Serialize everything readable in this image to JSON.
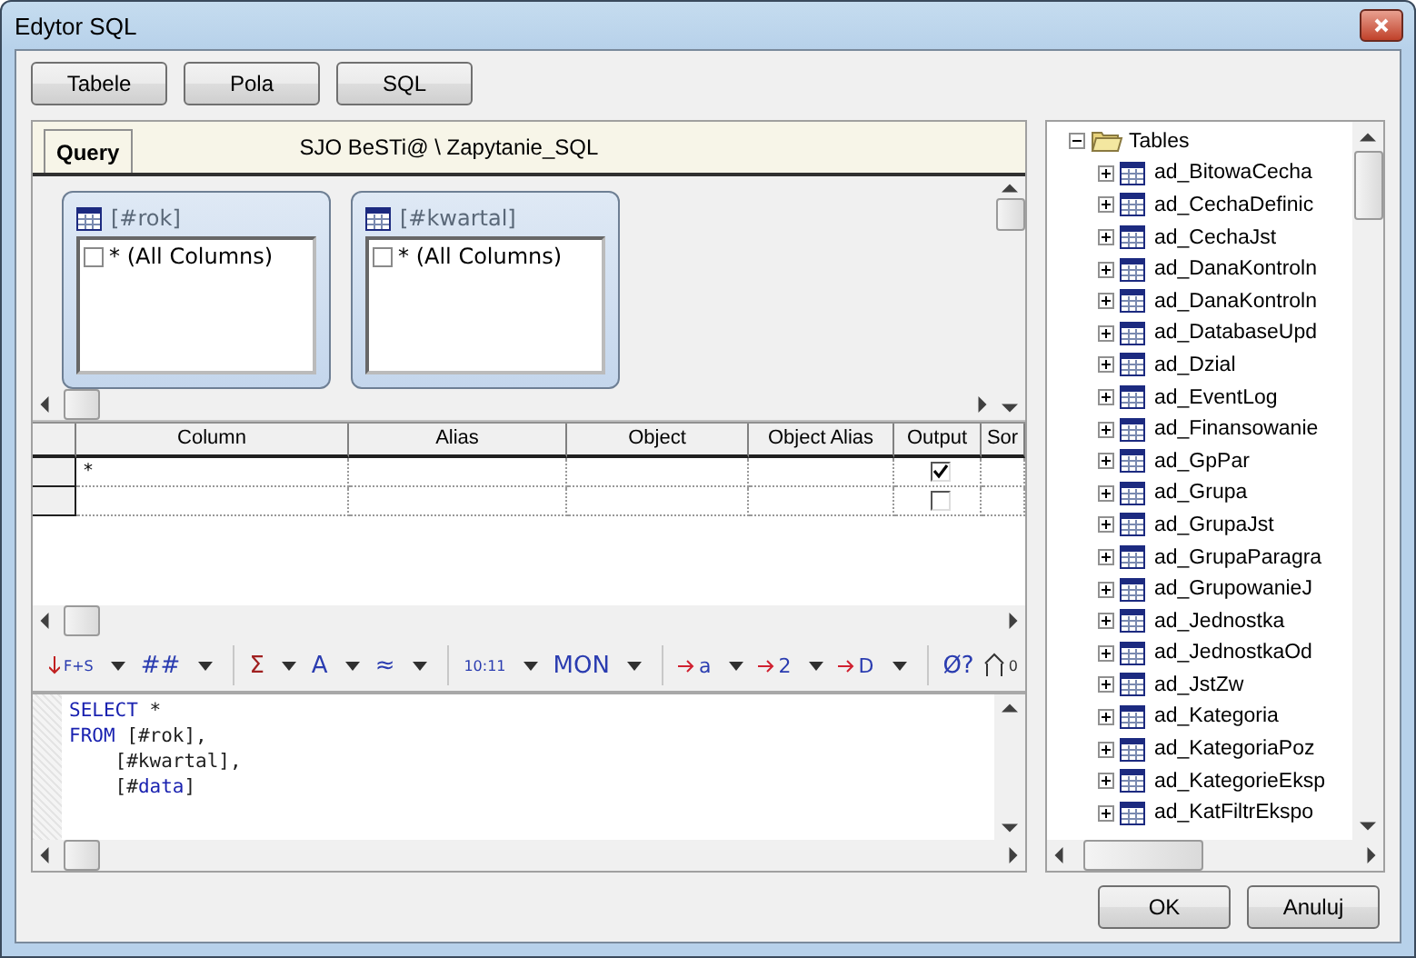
{
  "window": {
    "title": "Edytor SQL"
  },
  "top_buttons": [
    {
      "label": "Tabele"
    },
    {
      "label": "Pola"
    },
    {
      "label": "SQL"
    }
  ],
  "tabs": [
    {
      "label": "Query",
      "selected": true
    }
  ],
  "path": "SJO BeSTi@ \\ Zapytanie_SQL",
  "diagram_tables": [
    {
      "title": "[#rok]",
      "items": [
        {
          "label": "* (All Columns)",
          "checked": false
        }
      ]
    },
    {
      "title": "[#kwartal]",
      "items": [
        {
          "label": "* (All Columns)",
          "checked": false
        }
      ]
    }
  ],
  "grid": {
    "columns": [
      "Column",
      "Alias",
      "Object",
      "Object Alias",
      "Output",
      "Sor"
    ],
    "rows": [
      {
        "column": "*",
        "output": true
      },
      {
        "output": false
      }
    ]
  },
  "toolbar": [
    {
      "kind": "icon-text",
      "label": "F+S",
      "dropdown": true
    },
    {
      "kind": "text",
      "label": "##",
      "dropdown": true
    },
    {
      "kind": "sep"
    },
    {
      "kind": "text",
      "label": "Σ",
      "dropdown": true
    },
    {
      "kind": "text",
      "label": "A",
      "dropdown": true
    },
    {
      "kind": "text",
      "label": "≈",
      "dropdown": true
    },
    {
      "kind": "sep"
    },
    {
      "kind": "text",
      "label": "10:11",
      "dropdown": true
    },
    {
      "kind": "text",
      "label": "MON",
      "dropdown": true
    },
    {
      "kind": "sep"
    },
    {
      "kind": "arrow",
      "label": "a",
      "dropdown": true
    },
    {
      "kind": "arrow",
      "label": "2",
      "dropdown": true
    },
    {
      "kind": "arrow",
      "label": "D",
      "dropdown": true
    },
    {
      "kind": "sep"
    },
    {
      "kind": "text",
      "label": "Ø?",
      "dropdown": false
    },
    {
      "kind": "house",
      "label": "0",
      "dropdown": false
    }
  ],
  "sql_lines": [
    [
      {
        "kind": "keyword",
        "text": "SELECT"
      },
      {
        "kind": "plain",
        "text": " *"
      }
    ],
    [
      {
        "kind": "keyword",
        "text": "FROM"
      },
      {
        "kind": "plain",
        "text": " [#rok],"
      }
    ],
    [
      {
        "kind": "plain",
        "text": "    [#kwartal],"
      }
    ],
    [
      {
        "kind": "plain",
        "text": "    [#"
      },
      {
        "kind": "keyword",
        "text": "data"
      },
      {
        "kind": "plain",
        "text": "]"
      }
    ]
  ],
  "tree": {
    "label": "Tables",
    "expanded": true,
    "children": [
      {
        "label": "ad_BitowaCecha",
        "expanded": false
      },
      {
        "label": "ad_CechaDefinic",
        "expanded": false
      },
      {
        "label": "ad_CechaJst",
        "expanded": false
      },
      {
        "label": "ad_DanaKontroln",
        "expanded": false
      },
      {
        "label": "ad_DanaKontroln",
        "expanded": false
      },
      {
        "label": "ad_DatabaseUpd",
        "expanded": false
      },
      {
        "label": "ad_Dzial",
        "expanded": false
      },
      {
        "label": "ad_EventLog",
        "expanded": false
      },
      {
        "label": "ad_Finansowanie",
        "expanded": false
      },
      {
        "label": "ad_GpPar",
        "expanded": false
      },
      {
        "label": "ad_Grupa",
        "expanded": false
      },
      {
        "label": "ad_GrupaJst",
        "expanded": false
      },
      {
        "label": "ad_GrupaParagra",
        "expanded": false
      },
      {
        "label": "ad_GrupowanieJ",
        "expanded": false
      },
      {
        "label": "ad_Jednostka",
        "expanded": false
      },
      {
        "label": "ad_JednostkaOd",
        "expanded": false
      },
      {
        "label": "ad_JstZw",
        "expanded": false
      },
      {
        "label": "ad_Kategoria",
        "expanded": false
      },
      {
        "label": "ad_KategoriaPoz",
        "expanded": false
      },
      {
        "label": "ad_KategorieEksp",
        "expanded": false
      },
      {
        "label": "ad_KatFiltrEkspo",
        "expanded": false
      }
    ]
  },
  "bottom_buttons": [
    {
      "label": "OK"
    },
    {
      "label": "Anuluj"
    }
  ]
}
